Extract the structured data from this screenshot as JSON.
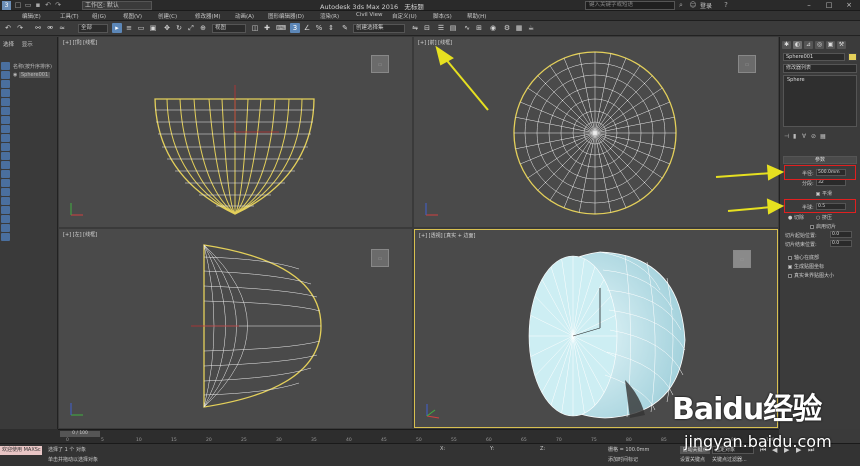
{
  "titlebar": {
    "workspace": "工作区: 默认",
    "app_title": "Autodesk 3ds Max 2016",
    "doc_title": "无标题",
    "search_placeholder": "键入关键字或短语",
    "login": "登录"
  },
  "menu": [
    "编辑(E)",
    "工具(T)",
    "组(G)",
    "视图(V)",
    "创建(C)",
    "修改器(M)",
    "动画(A)",
    "图形编辑器(D)",
    "渲染(R)",
    "Civil View",
    "自定义(U)",
    "脚本(S)",
    "帮助(H)"
  ],
  "toolbar": {
    "filter": "全部",
    "view_drop": "视图",
    "selset_drop": "创建选择集"
  },
  "left_panel": {
    "tabs": [
      "选择",
      "显示"
    ],
    "tree_header": "名称(按升序排序)",
    "tree_item": "Sphere001"
  },
  "viewports": {
    "top": "[+] [顶] [线框]",
    "front": "[+] [前] [线框]",
    "left": "[+] [左] [线框]",
    "persp": "[+] [透视] [真实 + 边面]"
  },
  "command_panel": {
    "object_name": "Sphere001",
    "modifier_list": "修改器列表",
    "stack_item": "Sphere",
    "rollout_title": "参数",
    "params": {
      "radius_label": "半径:",
      "radius_value": "500.0mm",
      "segments_label": "分段:",
      "segments_value": "32",
      "smooth_label": "平滑",
      "hemisphere_label": "半球:",
      "hemisphere_value": "0.5",
      "chop_label": "切除",
      "squash_label": "挤压",
      "slice_on_label": "启用切片",
      "slice_from_label": "切片起始位置:",
      "slice_from_value": "0.0",
      "slice_to_label": "切片结束位置:",
      "slice_to_value": "0.0",
      "base_pivot_label": "轴心在底部",
      "gen_map_label": "生成贴图坐标",
      "real_world_label": "真实世界贴图大小"
    }
  },
  "timeline": {
    "slider": "0 / 100",
    "ticks": [
      "0",
      "5",
      "10",
      "15",
      "20",
      "25",
      "30",
      "35",
      "40",
      "45",
      "50",
      "55",
      "60",
      "65",
      "70",
      "75",
      "80",
      "85",
      "90",
      "95",
      "100"
    ]
  },
  "statusbar": {
    "maxscript": "欢迎使用 MAXSc",
    "msg1": "选择了 1 个 对象",
    "msg2": "单击并拖动以选择对象",
    "x": "X:",
    "y": "Y:",
    "z": "Z:",
    "grid": "栅格 = 100.0mm",
    "add_time_tag": "添加时间标记",
    "auto_key": "自动关键点",
    "selected": "选定对象",
    "set_key": "设置关键点",
    "key_filters": "关键点过滤器..."
  },
  "watermark": {
    "brand_a": "Bai",
    "brand_b": "du",
    "brand_c": "经验",
    "site": "jingyan.baidu.com"
  },
  "colors": {
    "highlight": "#e02020",
    "arrow": "#e6e020",
    "selected_wire": "#e4d05a",
    "mesh_fill": "#bfe6ee"
  }
}
